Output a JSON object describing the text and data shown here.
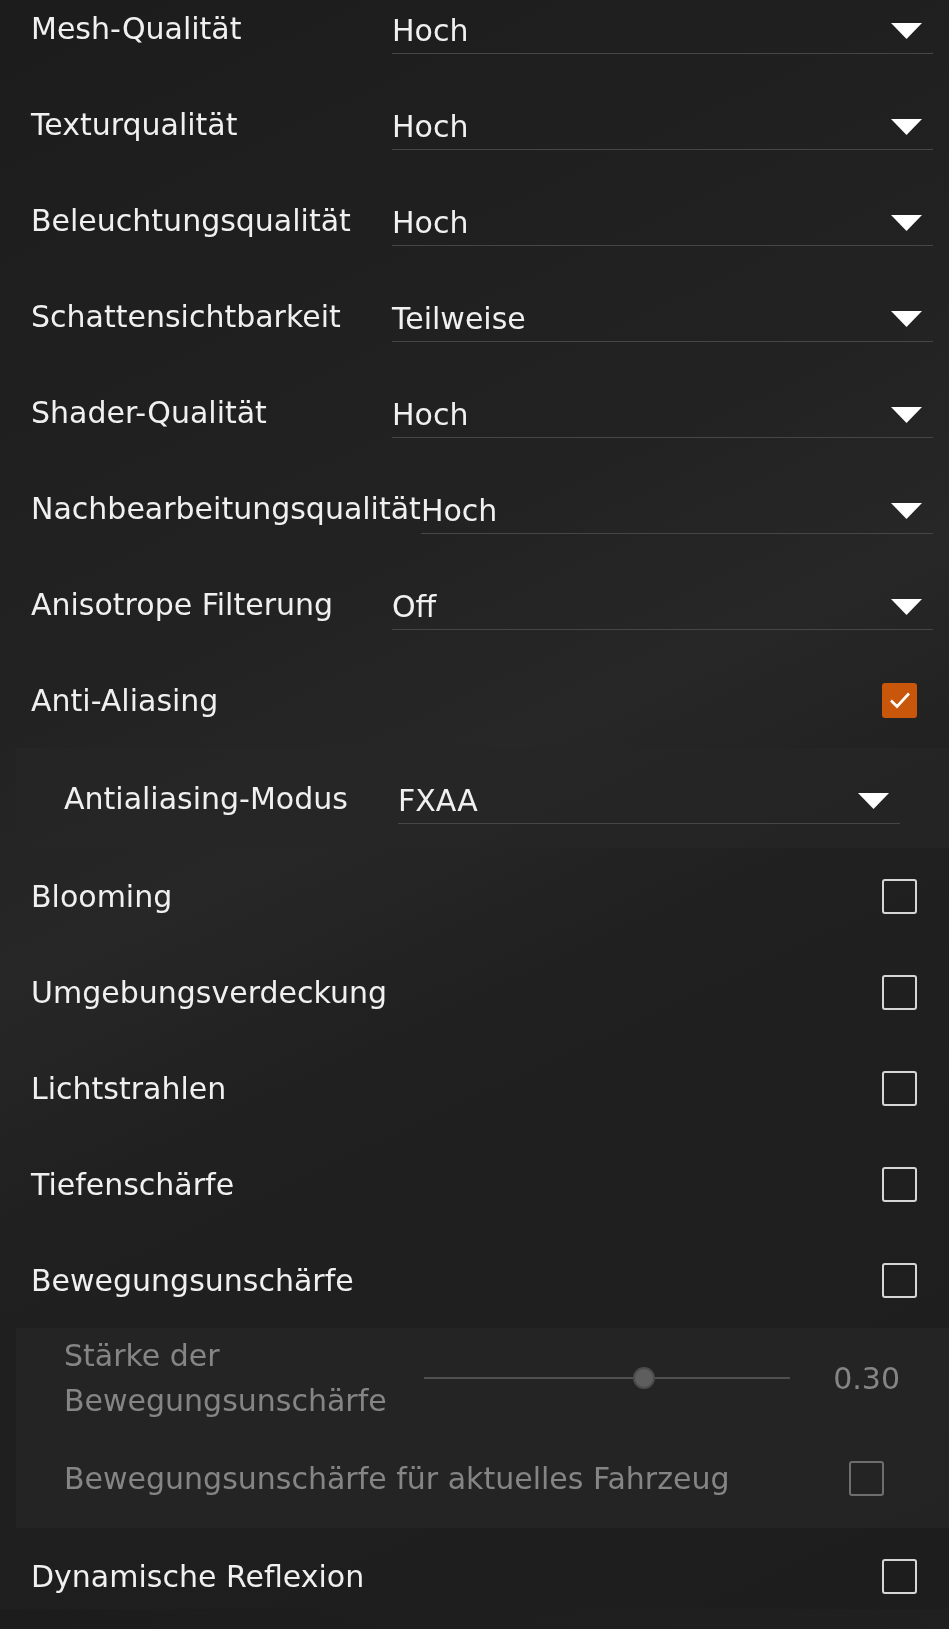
{
  "settings": [
    {
      "kind": "dropdown",
      "label": "Mesh-Qualität",
      "value": "Hoch",
      "disabled": false
    },
    {
      "kind": "dropdown",
      "label": "Texturqualität",
      "value": "Hoch",
      "disabled": false
    },
    {
      "kind": "dropdown",
      "label": "Beleuchtungsqualität",
      "value": "Hoch",
      "disabled": false
    },
    {
      "kind": "dropdown",
      "label": "Schattensichtbarkeit",
      "value": "Teilweise",
      "disabled": false
    },
    {
      "kind": "dropdown",
      "label": "Shader-Qualität",
      "value": "Hoch",
      "disabled": false
    },
    {
      "kind": "dropdown",
      "label": "Nachbearbeitungsqualität",
      "value": "Hoch",
      "disabled": false
    },
    {
      "kind": "dropdown",
      "label": "Anisotrope Filterung",
      "value": "Off",
      "disabled": false
    },
    {
      "kind": "checkbox",
      "label": "Anti-Aliasing",
      "checked": true,
      "disabled": false,
      "children": [
        {
          "kind": "dropdown",
          "label": "Antialiasing-Modus",
          "value": "FXAA",
          "disabled": false
        }
      ]
    },
    {
      "kind": "checkbox",
      "label": "Blooming",
      "checked": false,
      "disabled": false
    },
    {
      "kind": "checkbox",
      "label": "Umgebungsverdeckung",
      "checked": false,
      "disabled": false
    },
    {
      "kind": "checkbox",
      "label": "Lichtstrahlen",
      "checked": false,
      "disabled": false
    },
    {
      "kind": "checkbox",
      "label": "Tiefenschärfe",
      "checked": false,
      "disabled": false
    },
    {
      "kind": "checkbox",
      "label": "Bewegungsunschärfe",
      "checked": false,
      "disabled": false,
      "children": [
        {
          "kind": "slider",
          "label": "Stärke der Bewegungsunschärfe",
          "level": 0.6,
          "reading": "0.30",
          "disabled": true
        },
        {
          "kind": "checkbox",
          "label": "Bewegungsunschärfe für aktuelles Fahrzeug",
          "checked": false,
          "disabled": true
        }
      ]
    },
    {
      "kind": "checkbox",
      "label": "Dynamische Reflexion",
      "checked": false,
      "disabled": false
    }
  ]
}
